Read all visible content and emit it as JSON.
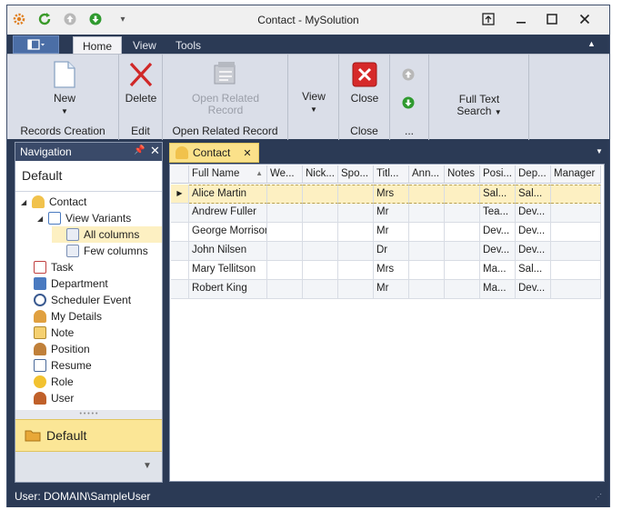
{
  "window": {
    "title": "Contact - MySolution"
  },
  "ribbon": {
    "tabs": [
      "Home",
      "View",
      "Tools"
    ],
    "groups": [
      {
        "caption": "Records Creation",
        "buttons": [
          {
            "label": "New",
            "icon": "new-document-icon",
            "dropdown": true
          }
        ]
      },
      {
        "caption": "Edit",
        "buttons": [
          {
            "label": "Delete",
            "icon": "delete-x-icon"
          }
        ]
      },
      {
        "caption": "Open Related Record",
        "buttons": [
          {
            "label": "Open Related Record",
            "icon": "open-related-icon",
            "disabled": true
          }
        ]
      },
      {
        "caption": "",
        "buttons": [
          {
            "label": "View",
            "icon": "",
            "dropdown": true
          }
        ]
      },
      {
        "caption": "Close",
        "buttons": [
          {
            "label": "Close",
            "icon": "close-red-icon"
          }
        ]
      },
      {
        "caption": "...",
        "buttons": [
          {
            "label": "",
            "icon": "up-arrow-icon"
          },
          {
            "label": "",
            "icon": "down-arrow-icon"
          }
        ]
      },
      {
        "caption": "",
        "buttons": [
          {
            "label": "Full Text Search",
            "icon": "",
            "dropdown": true
          }
        ]
      }
    ]
  },
  "navigation": {
    "header": "Navigation",
    "title": "Default",
    "items": [
      {
        "label": "Contact",
        "icon": "contact-icon",
        "level": 0,
        "expanded": true
      },
      {
        "label": "View Variants",
        "icon": "view-variants-icon",
        "level": 1,
        "expanded": true
      },
      {
        "label": "All columns",
        "icon": "list-view-icon",
        "level": 2,
        "selected": true
      },
      {
        "label": "Few columns",
        "icon": "list-view-icon",
        "level": 2
      },
      {
        "label": "Task",
        "icon": "task-icon",
        "level": 0
      },
      {
        "label": "Department",
        "icon": "department-icon",
        "level": 0
      },
      {
        "label": "Scheduler Event",
        "icon": "clock-icon",
        "level": 0
      },
      {
        "label": "My Details",
        "icon": "my-details-icon",
        "level": 0
      },
      {
        "label": "Note",
        "icon": "note-icon",
        "level": 0
      },
      {
        "label": "Position",
        "icon": "position-icon",
        "level": 0
      },
      {
        "label": "Resume",
        "icon": "resume-icon",
        "level": 0
      },
      {
        "label": "Role",
        "icon": "role-icon",
        "level": 0
      },
      {
        "label": "User",
        "icon": "user-icon",
        "level": 0
      }
    ],
    "group": "Default"
  },
  "document": {
    "tab": "Contact",
    "grid": {
      "columns": [
        "Full Name",
        "We...",
        "Nick...",
        "Spo...",
        "Titl...",
        "Ann...",
        "Notes",
        "Posi...",
        "Dep...",
        "Manager"
      ],
      "rows": [
        [
          "Alice Martin",
          "",
          "",
          "",
          "Mrs",
          "",
          "",
          "Sal...",
          "Sal...",
          ""
        ],
        [
          "Andrew Fuller",
          "",
          "",
          "",
          "Mr",
          "",
          "",
          "Tea...",
          "Dev...",
          ""
        ],
        [
          "George Morrison",
          "",
          "",
          "",
          "Mr",
          "",
          "",
          "Dev...",
          "Dev...",
          ""
        ],
        [
          "John Nilsen",
          "",
          "",
          "",
          "Dr",
          "",
          "",
          "Dev...",
          "Dev...",
          ""
        ],
        [
          "Mary Tellitson",
          "",
          "",
          "",
          "Mrs",
          "",
          "",
          "Ma...",
          "Sal...",
          ""
        ],
        [
          "Robert King",
          "",
          "",
          "",
          "Mr",
          "",
          "",
          "Ma...",
          "Dev...",
          ""
        ]
      ],
      "selected_row": 0
    }
  },
  "status": {
    "user": "User: DOMAIN\\SampleUser"
  },
  "colors": {
    "frame": "#2b3a55",
    "ribbon": "#dadee8",
    "selection": "#fbe696",
    "accent": "#3a4a69"
  }
}
